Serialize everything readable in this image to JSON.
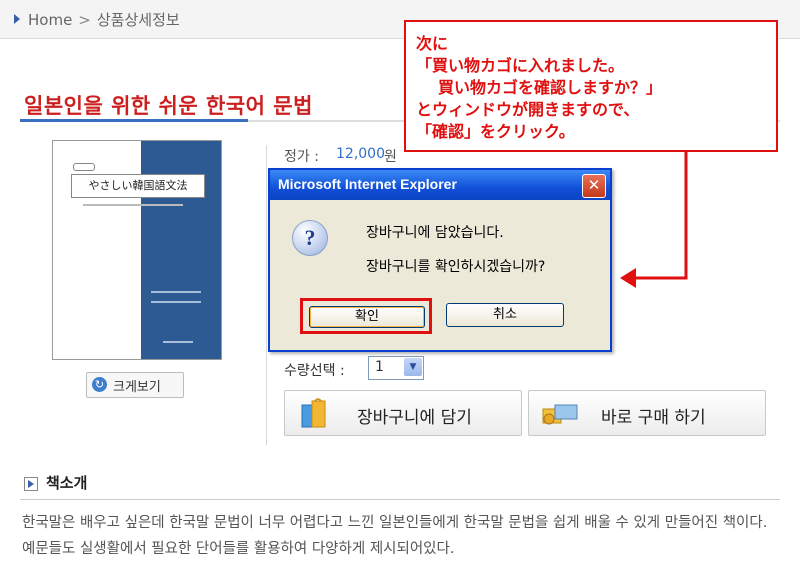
{
  "breadcrumb": {
    "home": "Home",
    "separator": ">",
    "current": "상품상세정보"
  },
  "product": {
    "title": "일본인을 위한 쉬운 한국어 문법",
    "zoom_label": "크게보기",
    "cover_title": "やさしい韓国語文法"
  },
  "price": {
    "label": "정가 : ",
    "value": "12,000",
    "unit": "원"
  },
  "dialog": {
    "title": "Microsoft Internet Explorer",
    "close": "✕",
    "icon": "?",
    "message1": "장바구니에 담았습니다.",
    "message2": "장바구니를 확인하시겠습니까?",
    "ok_label": "확인",
    "cancel_label": "취소"
  },
  "annotation": {
    "line1": "次に",
    "line2": "「買い物カゴに入れました。",
    "line3": "買い物カゴを確認しますか？」",
    "line4": "とウィンドウが開きますので、",
    "line5": "「確認」をクリック。"
  },
  "quantity": {
    "label": "수량선택 :",
    "value": "1"
  },
  "buttons": {
    "cart_label": "장바구니에 담기",
    "buy_label": "바로 구매 하기"
  },
  "intro": {
    "title": "책소개",
    "text": "한국말은 배우고 싶은데 한국말 문법이 너무 어렵다고 느낀 일본인들에게 한국말 문법을 쉽게 배울 수 있게 만들어진 책이다. 예문들도 실생활에서 필요한 단어들를 활용하여 다양하게 제시되어있다."
  },
  "colors": {
    "accent_red": "#e01010",
    "title_red": "#cc1f1f",
    "link_blue": "#2f6fc7",
    "xp_blue": "#0b44c4"
  }
}
